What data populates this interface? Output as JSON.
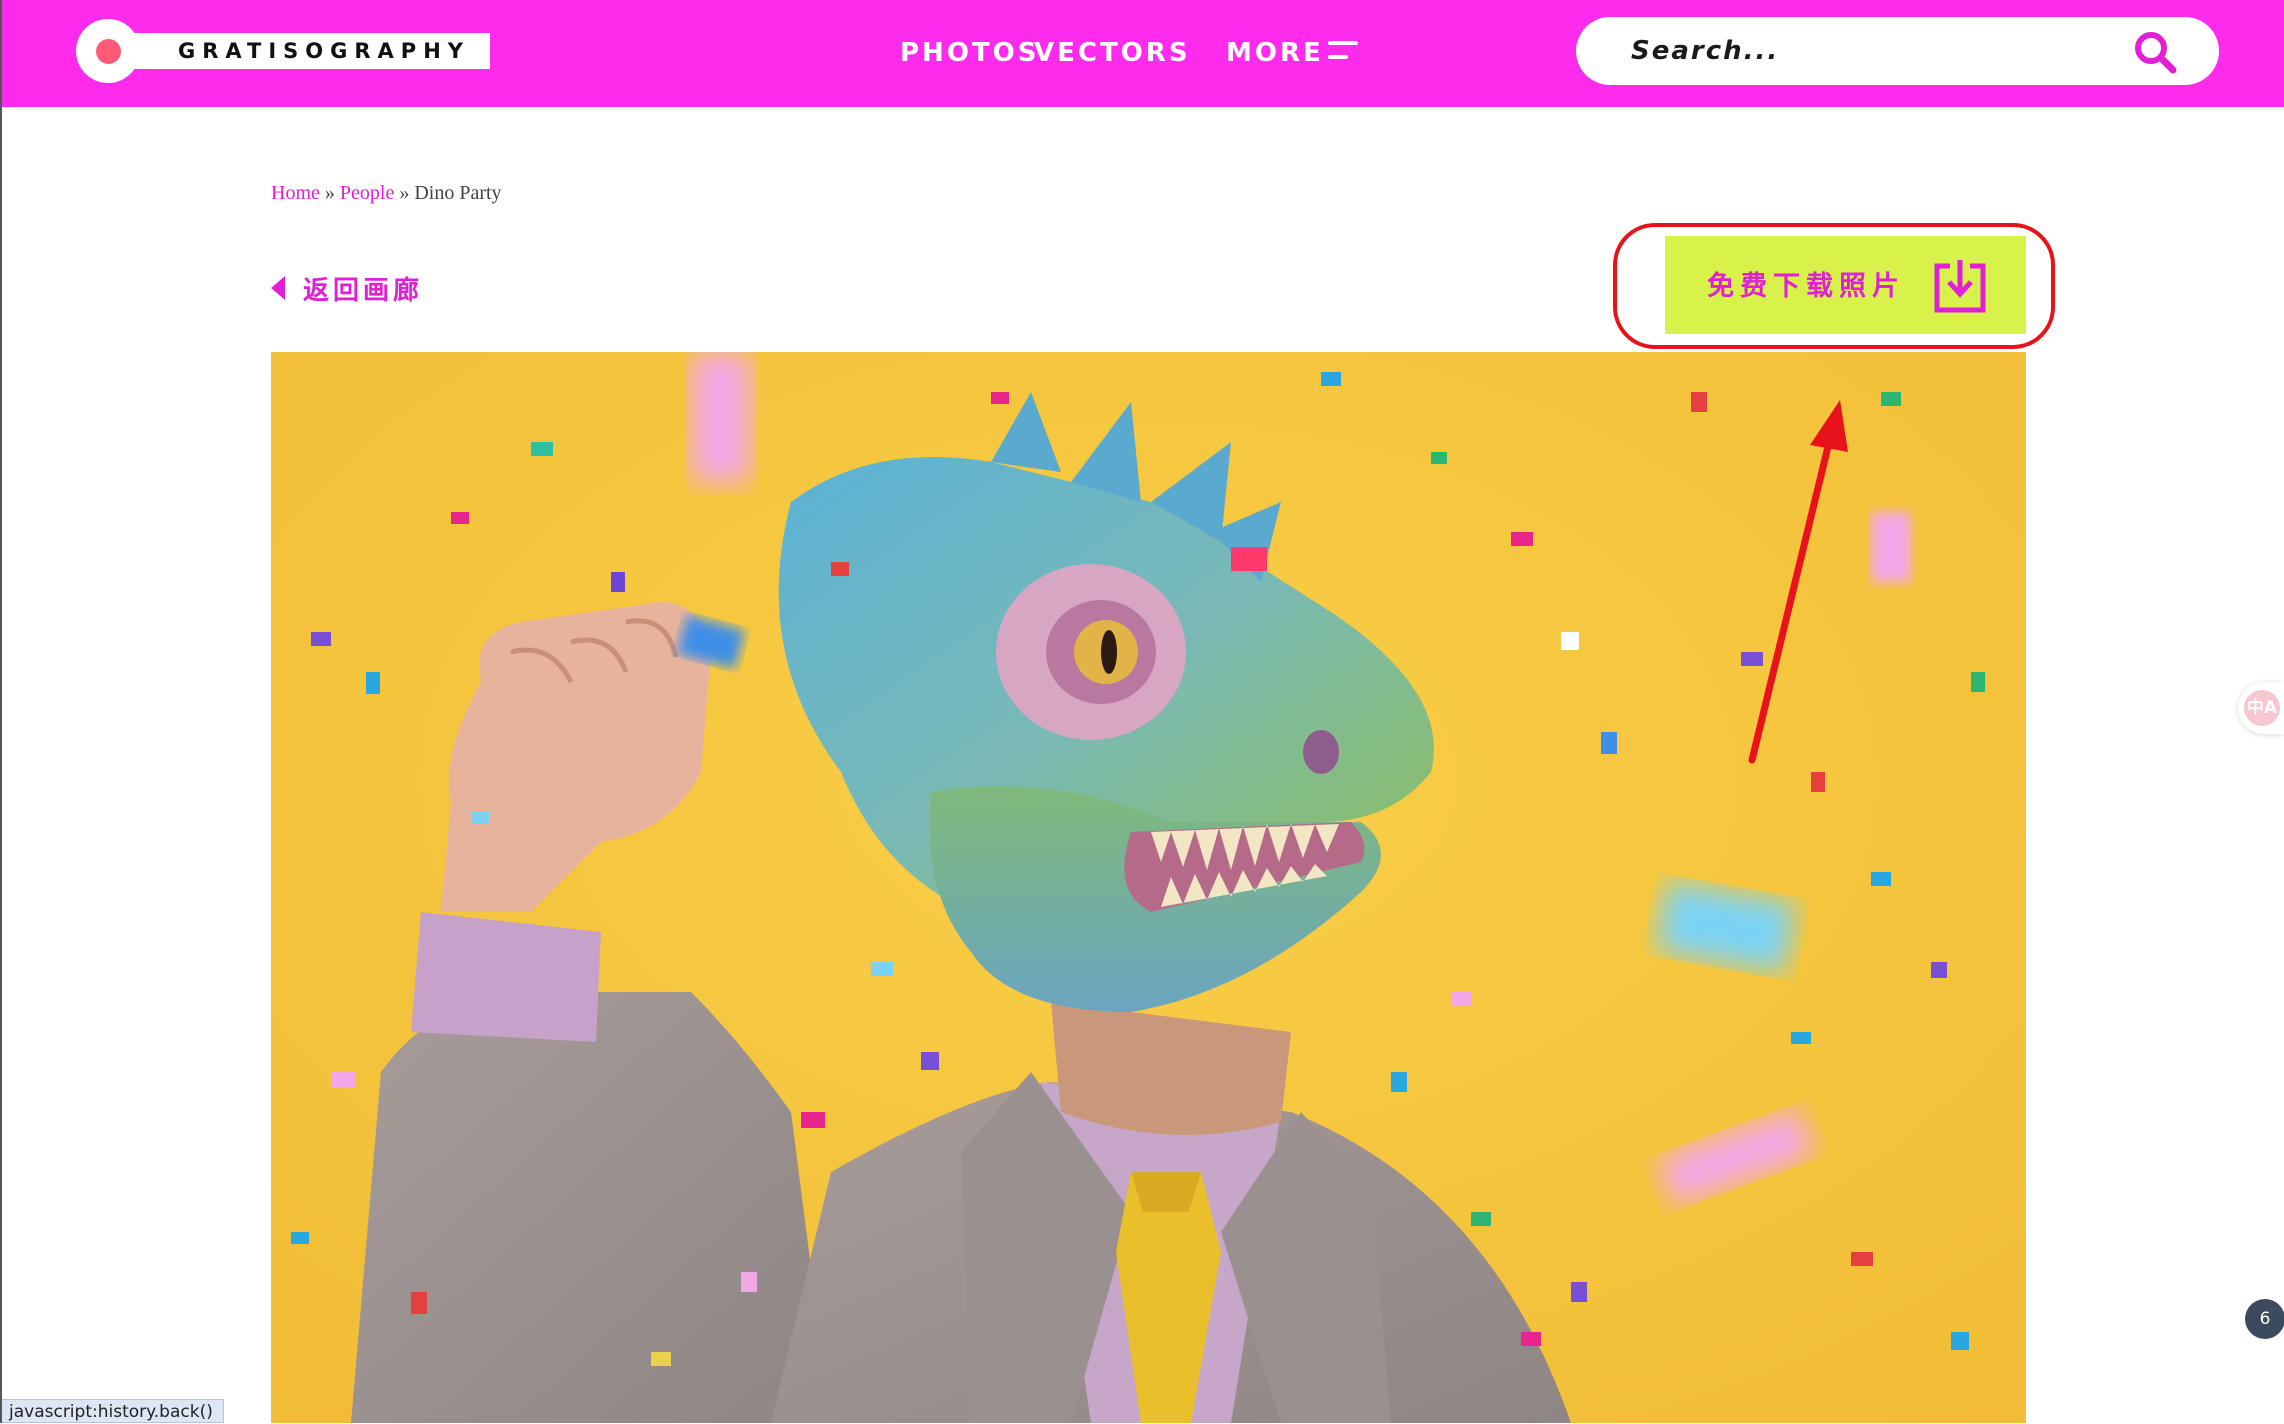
{
  "header": {
    "logo_text": "GRATISOGRAPHY",
    "nav": [
      {
        "label": "PHOTOS"
      },
      {
        "label": "VECTORS"
      },
      {
        "label": "MORE"
      }
    ],
    "search_placeholder": "Search..."
  },
  "breadcrumb": {
    "home": "Home",
    "separator": "»",
    "category": "People",
    "current": "Dino Party"
  },
  "back_link": "返回画廊",
  "download_button": "免费下载照片",
  "photo": {
    "alt": "Dino Party"
  },
  "side": {
    "translate_glyph": "中A",
    "notification_count": "6"
  },
  "status_bar": "javascript:history.back()",
  "colors": {
    "brand_magenta": "#ff2bec",
    "link_magenta": "#e11fd6",
    "download_bg": "#d9f24b",
    "annotation_red": "#e8121b",
    "photo_background": "#f6c53d"
  },
  "icons": [
    "menu-icon",
    "search-icon",
    "back-arrow-icon",
    "download-icon",
    "translate-icon"
  ]
}
